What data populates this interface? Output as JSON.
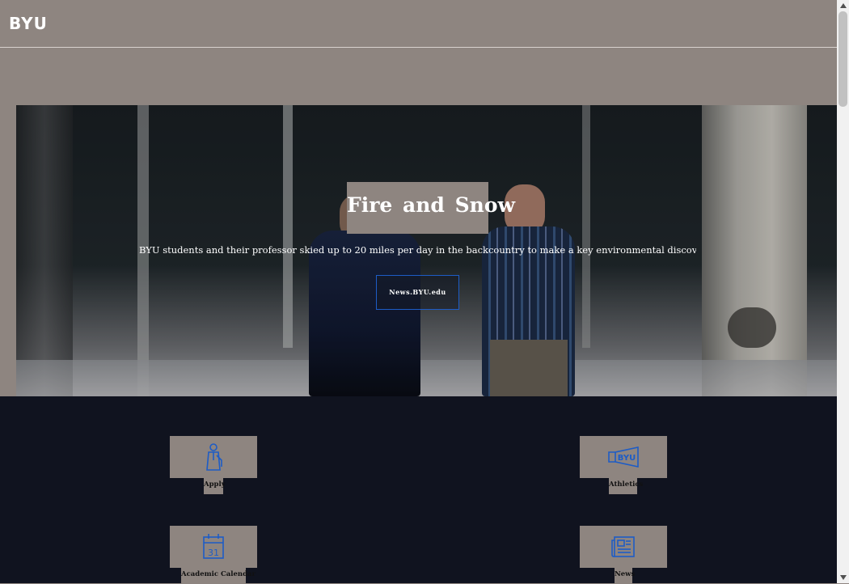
{
  "header": {
    "logo_text": "BYU"
  },
  "hero": {
    "title": "Fire and Snow",
    "subtitle": "BYU students and their professor skied up to 20 miles per day in the backcountry to make a key environmental discovery.",
    "button_label": "News.BYU.edu"
  },
  "quick_links": [
    {
      "label": "Apply",
      "icon": "graduate-icon"
    },
    {
      "label": "Athletics",
      "icon": "megaphone-icon"
    },
    {
      "label": "Academic Calendar",
      "icon": "calendar-icon"
    },
    {
      "label": "News",
      "icon": "newspaper-icon"
    }
  ],
  "calendar_icon_day": "31",
  "athletics_icon_text": "BYU",
  "colors": {
    "header_bg": "#8e8580",
    "quick_links_bg": "#10131f",
    "accent_blue": "#1d5cc6"
  }
}
